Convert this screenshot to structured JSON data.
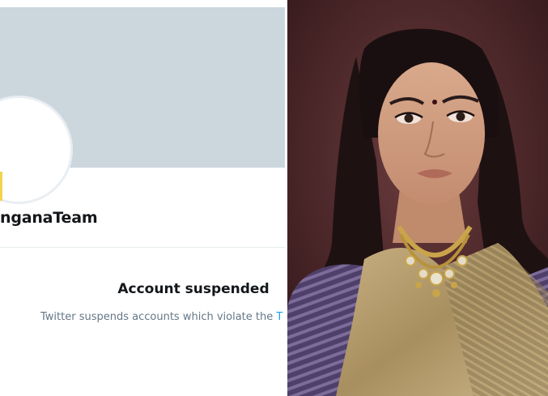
{
  "profile": {
    "handle_visible": "nganaTeam",
    "suspended_title": "Account suspended",
    "suspended_text": "Twitter suspends accounts which violate the ",
    "suspended_link_fragment": "T"
  },
  "colors": {
    "banner": "#ccd6dd",
    "primary_text": "#14171a",
    "secondary_text": "#657786",
    "link": "#1da1f2",
    "photo_background": "#4a2a2c",
    "saree_stripes": "#5b4a78",
    "saree_gold": "#b49a66"
  },
  "icons": {
    "avatar": "default-avatar-placeholder"
  }
}
